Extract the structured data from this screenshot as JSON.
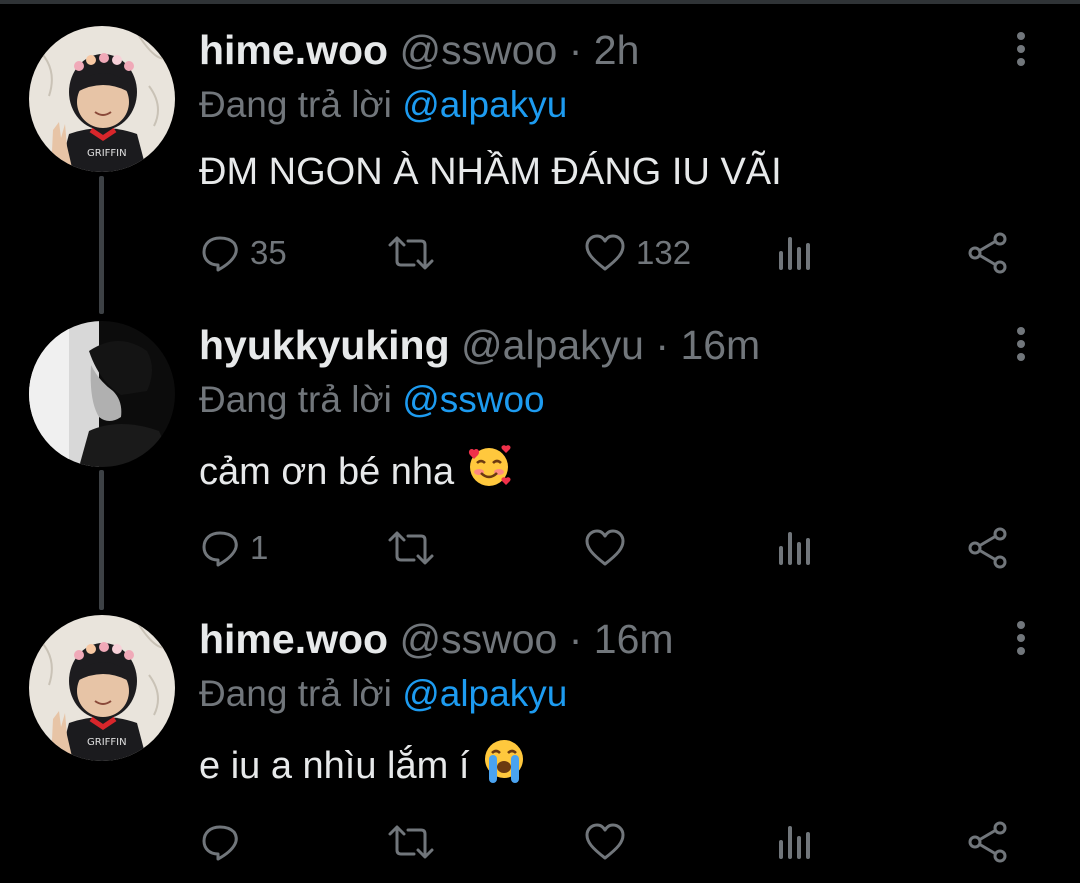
{
  "tweets": [
    {
      "name": "hime.woo",
      "handle": "@sswoo",
      "separator": "·",
      "time": "2h",
      "replying_prefix": "Đang trả lời",
      "replying_to": "@alpakyu",
      "text": "ĐM NGON À NHẦM ĐÁNG IU VÃI",
      "emoji": "",
      "replies": "35",
      "retweets": "",
      "likes": "132",
      "avatar_jersey_text": "GRIFFIN"
    },
    {
      "name": "hyukkyuking",
      "handle": "@alpakyu",
      "separator": "·",
      "time": "16m",
      "replying_prefix": "Đang trả lời",
      "replying_to": "@sswoo",
      "text": "cảm ơn bé nha",
      "emoji": "smiling-face-with-hearts",
      "replies": "1",
      "retweets": "",
      "likes": ""
    },
    {
      "name": "hime.woo",
      "handle": "@sswoo",
      "separator": "·",
      "time": "16m",
      "replying_prefix": "Đang trả lời",
      "replying_to": "@alpakyu",
      "text": "e iu a nhìu lắm í",
      "emoji": "loudly-crying-face",
      "replies": "",
      "retweets": "",
      "likes": "",
      "avatar_jersey_text": "GRIFFIN"
    }
  ],
  "icons": {
    "reply": "reply-icon",
    "retweet": "retweet-icon",
    "like": "heart-icon",
    "stats": "analytics-icon",
    "share": "share-icon",
    "more": "more-vertical-icon"
  },
  "colors": {
    "background": "#000000",
    "name": "#e7e9ea",
    "muted": "#71767b",
    "mention": "#1d9bf0",
    "thread_line": "#3d4145"
  }
}
